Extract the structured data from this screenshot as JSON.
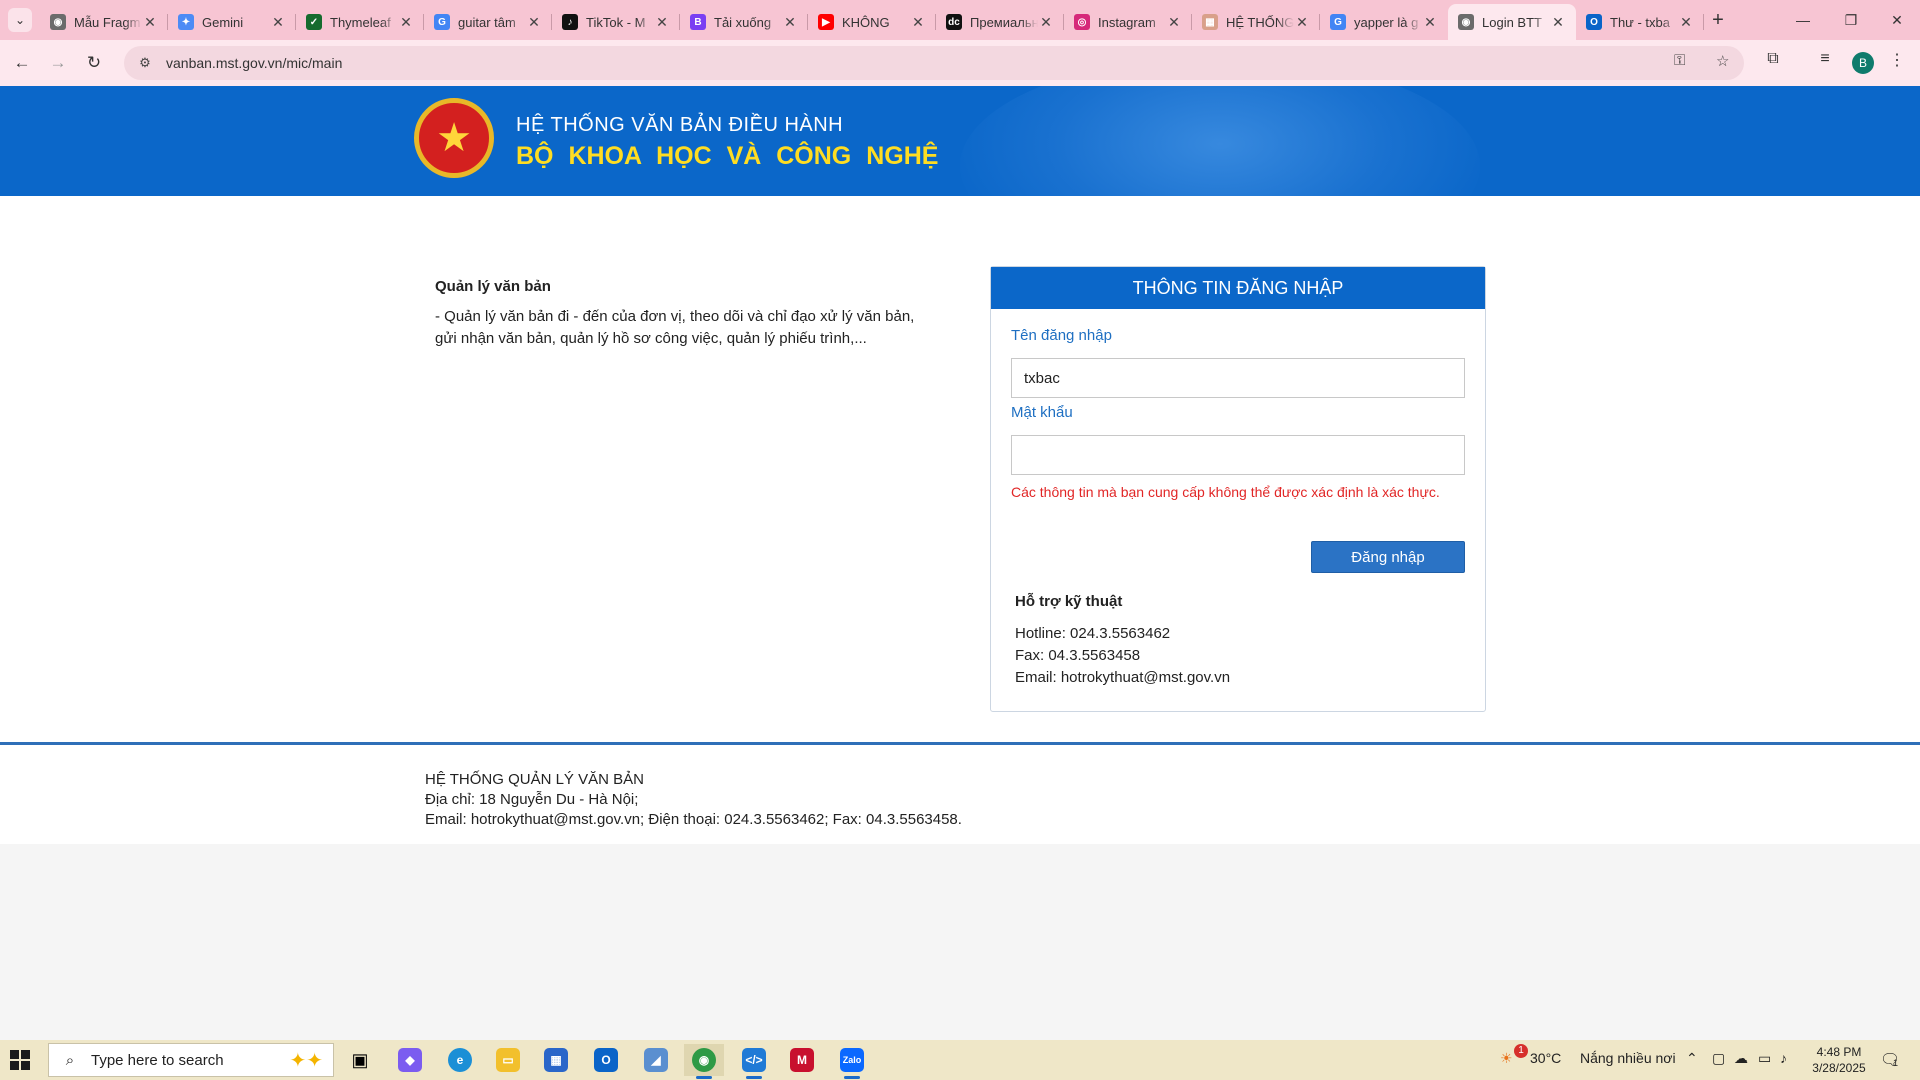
{
  "browser": {
    "tabs": [
      {
        "title": "Mẫu Fragm",
        "favicon_color": "#6b6b6b",
        "favicon_glyph": "◉"
      },
      {
        "title": "Gemini",
        "favicon_color": "#4c8bf5",
        "favicon_glyph": "✦"
      },
      {
        "title": "Thymeleaf",
        "favicon_color": "#156b2e",
        "favicon_glyph": "✓"
      },
      {
        "title": "guitar tâm",
        "favicon_color": "#4285f4",
        "favicon_glyph": "G"
      },
      {
        "title": "TikTok - M",
        "favicon_color": "#111111",
        "favicon_glyph": "♪"
      },
      {
        "title": "Tải xuống",
        "favicon_color": "#7a3ff2",
        "favicon_glyph": "B"
      },
      {
        "title": "KHÔNG",
        "favicon_color": "#ff0000",
        "favicon_glyph": "▶"
      },
      {
        "title": "Премиальн",
        "favicon_color": "#111111",
        "favicon_glyph": "dc"
      },
      {
        "title": "Instagram",
        "favicon_color": "#d6297a",
        "favicon_glyph": "◎"
      },
      {
        "title": "HỆ THỐNG",
        "favicon_color": "#d9a08a",
        "favicon_glyph": "▦"
      },
      {
        "title": "yapper là g",
        "favicon_color": "#4285f4",
        "favicon_glyph": "G"
      },
      {
        "title": "Login BTT",
        "favicon_color": "#6b6b6b",
        "favicon_glyph": "◉"
      },
      {
        "title": "Thư - txba",
        "favicon_color": "#0a64c8",
        "favicon_glyph": "O"
      }
    ],
    "active_tab_index": 11,
    "url": "vanban.mst.gov.vn/mic/main",
    "profile_initial": "B"
  },
  "banner": {
    "line1": "HỆ THỐNG VĂN BẢN ĐIỀU HÀNH",
    "line2": "BỘ KHOA HỌC VÀ CÔNG NGHỆ"
  },
  "intro": {
    "title": "Quản lý văn bản",
    "text": "- Quản lý văn bản đi - đến của đơn vị, theo dõi và chỉ đạo xử lý văn bản, gửi nhận văn bản, quản lý hồ sơ công việc, quản lý phiếu trình,..."
  },
  "login": {
    "header": "THÔNG TIN ĐĂNG NHẬP",
    "username_label": "Tên đăng nhập",
    "username_value": "txbac",
    "password_label": "Mật khẩu",
    "password_value": "",
    "error": "Các thông tin mà bạn cung cấp không thể được xác định là xác thực.",
    "submit_label": "Đăng nhập"
  },
  "support": {
    "title": "Hỗ trợ kỹ thuật",
    "hotline": "Hotline: 024.3.5563462",
    "fax": "Fax: 04.3.5563458",
    "email": "Email: hotrokythuat@mst.gov.vn"
  },
  "footer": {
    "line1": "HỆ THỐNG QUẢN LÝ VĂN BẢN",
    "line2": "Địa chỉ: 18 Nguyễn Du - Hà Nội;",
    "line3": "Email: hotrokythuat@mst.gov.vn; Điện thoại: 024.3.5563462; Fax: 04.3.5563458."
  },
  "taskbar": {
    "search_placeholder": "Type here to search",
    "weather_temp": "30°C",
    "weather_text": "Nắng nhiều nơi",
    "weather_badge": "1",
    "time": "4:48 PM",
    "date": "3/28/2025",
    "notification_count": "1"
  }
}
